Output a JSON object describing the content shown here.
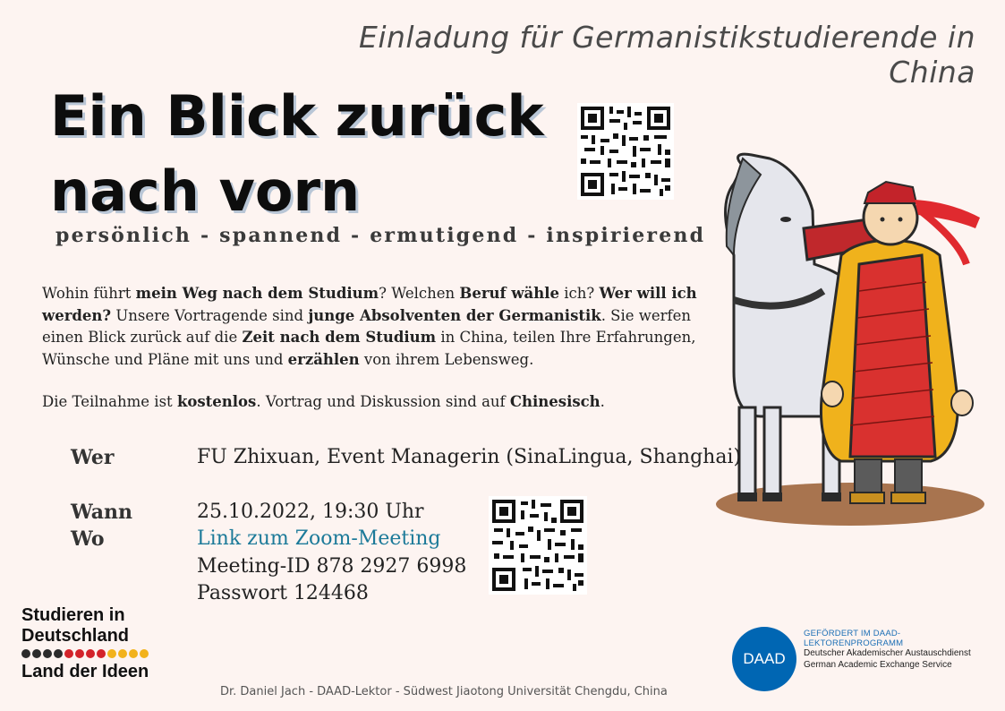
{
  "header": {
    "subtitle": "Einladung für Germanistikstudierende in China",
    "title_line1": "Ein Blick zurück",
    "title_line2": "nach vorn",
    "tagline": "persönlich - spannend - ermutigend - inspirierend"
  },
  "intro": {
    "p1": "Wohin führt ",
    "p1_b": "mein Weg nach dem Studium",
    "p2": "? Welchen ",
    "p2_b": "Beruf wähle",
    "p3": " ich? ",
    "p3_b": "Wer will ich werden?",
    "p4": " Unsere Vortragende sind ",
    "p4_b": "junge Absolventen der Germanistik",
    "p5": ". Sie werfen einen Blick zurück auf die ",
    "p5_b": "Zeit nach dem Studium",
    "p6": " in China, teilen Ihre Erfahrungen, Wünsche und Pläne mit uns und ",
    "p6_b": "erzählen",
    "p7": " von ihrem Lebensweg."
  },
  "note": {
    "n1": "Die Teilnahme ist ",
    "n1_b": "kostenlos",
    "n2": ". Vortrag und Diskussion sind auf ",
    "n2_b": "Chinesisch",
    "n3": "."
  },
  "details": {
    "who_label": "Wer",
    "who_value": "FU Zhixuan, Event Managerin (SinaLingua, Shanghai)",
    "when_label": "Wann",
    "when_value": "25.10.2022, 19:30 Uhr",
    "where_label": "Wo",
    "zoom_link": "Link zum Zoom-Meeting",
    "meeting_id": "Meeting-ID 878 2927 6998",
    "password": "Passwort 124468"
  },
  "logos": {
    "sid_line1": "Studieren in",
    "sid_line2": "Deutschland",
    "sid_line3": "Land der Ideen",
    "daad_circle": "DAAD",
    "daad_funded": "GEFÖRDERT IM DAAD-LEKTORENPROGRAMM",
    "daad_de": "Deutscher Akademischer Austauschdienst",
    "daad_en": "German Academic Exchange Service"
  },
  "footer": "Dr. Daniel Jach - DAAD-Lektor - Südwest Jiaotong Universität Chengdu, China",
  "colors": {
    "background": "#fdf4f1",
    "link": "#1c7a99",
    "daad_blue": "#0066b3"
  }
}
